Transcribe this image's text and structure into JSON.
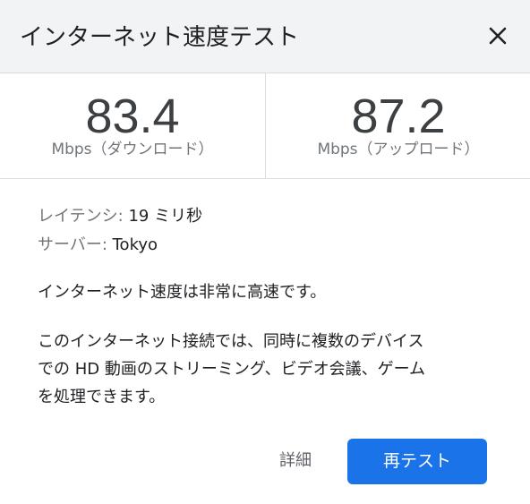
{
  "header": {
    "title": "インターネット速度テスト",
    "close_icon": "close-icon"
  },
  "download": {
    "value": "83.4",
    "unit": "Mbps（ダウンロード）"
  },
  "upload": {
    "value": "87.2",
    "unit": "Mbps（アップロード）"
  },
  "meta": {
    "latency_label": "レイテンシ:",
    "latency_value": "19 ミリ秒",
    "server_label": "サーバー:",
    "server_value": "Tokyo"
  },
  "verdict": "インターネット速度は非常に高速です。",
  "description_lines": [
    "このインターネット接続では、同時に複数のデバイス",
    "での HD 動画のストリーミング、ビデオ会議、ゲーム",
    "を処理できます。"
  ],
  "actions": {
    "details_label": "詳細",
    "retest_label": "再テスト"
  },
  "colors": {
    "primary": "#1a73e8",
    "header_bg": "#f1f3f4",
    "secondary_text": "#70757a"
  }
}
